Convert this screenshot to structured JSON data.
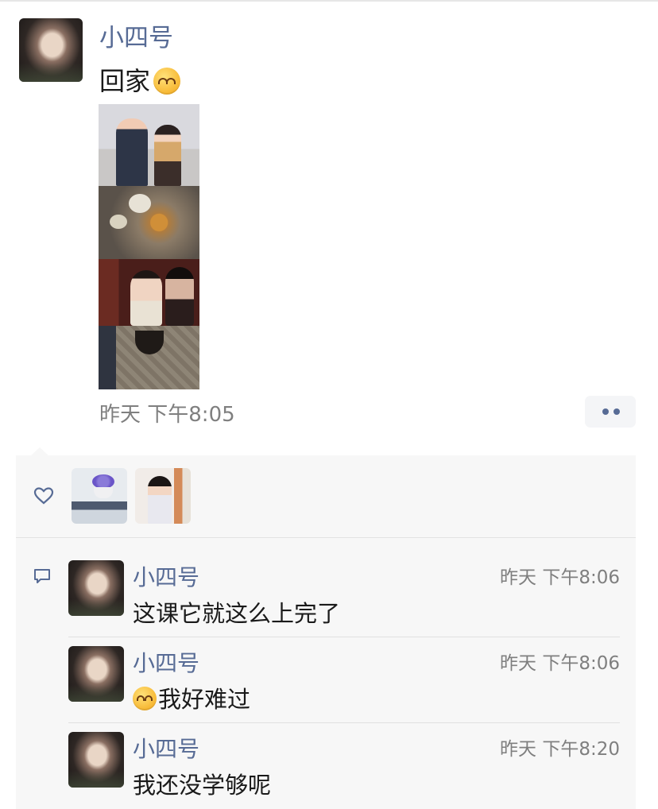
{
  "post": {
    "author": "小四号",
    "text": "回家",
    "text_emoji": "pleading-face-emoji",
    "time": "昨天 下午8:05",
    "photos": [
      "photo-1",
      "photo-2",
      "photo-3",
      "photo-4"
    ]
  },
  "actions": {
    "more_icon": "ellipsis-icon"
  },
  "likes": {
    "icon": "heart-icon",
    "users": [
      "liker-1",
      "liker-2"
    ]
  },
  "comments": [
    {
      "author": "小四号",
      "time": "昨天 下午8:06",
      "text": "这课它就这么上完了",
      "emoji": ""
    },
    {
      "author": "小四号",
      "time": "昨天 下午8:06",
      "text": "我好难过",
      "emoji": "pleading-face-emoji"
    },
    {
      "author": "小四号",
      "time": "昨天 下午8:20",
      "text": "我还没学够呢",
      "emoji": ""
    }
  ],
  "colors": {
    "name_link": "#576b95",
    "time_gray": "#7f7f7f",
    "panel_bg": "#f7f7f7"
  }
}
